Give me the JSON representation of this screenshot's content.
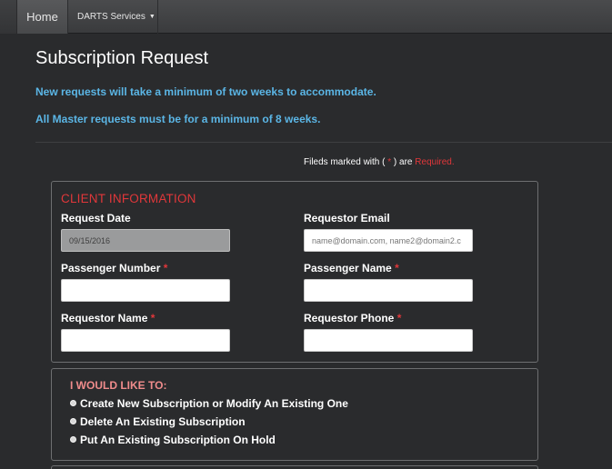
{
  "nav": {
    "home_label": "Home",
    "services_label": "DARTS Services",
    "services_caret": "▼"
  },
  "page": {
    "title": "Subscription Request",
    "notice_1": "New requests will take a minimum of two weeks to accommodate.",
    "notice_2": "All Master requests must be for a minimum of 8 weeks."
  },
  "required_note": {
    "prefix": "Fileds marked with ( ",
    "star": "*",
    "middle": " ) are ",
    "word": "Required."
  },
  "client": {
    "legend": "CLIENT INFORMATION",
    "request_date_label": "Request Date",
    "request_date_value": "09/15/2016",
    "requestor_email_label": "Requestor Email",
    "requestor_email_placeholder": "name@domain.com, name2@domain2.c",
    "passenger_number_label": "Passenger Number",
    "passenger_name_label": "Passenger Name",
    "requestor_name_label": "Requestor Name",
    "requestor_phone_label": "Requestor Phone",
    "required_star": "*"
  },
  "options": {
    "legend": "I WOULD LIKE TO:",
    "items": [
      "Create New Subscription or Modify An Existing One",
      "Delete An Existing Subscription",
      "Put An Existing Subscription On Hold"
    ]
  },
  "colors": {
    "background": "#2a2b2d",
    "accent_blue": "#5bb6e6",
    "required_red": "#e0373a"
  }
}
